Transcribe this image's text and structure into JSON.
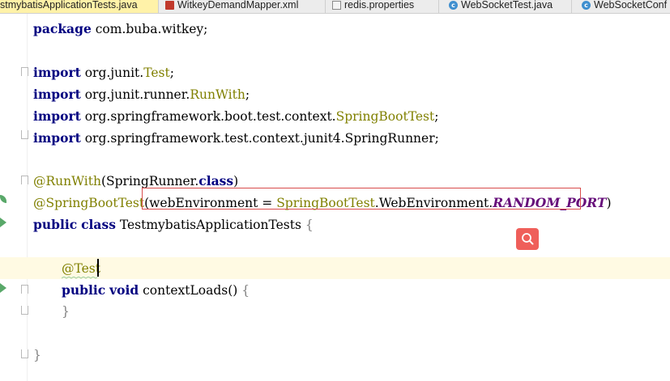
{
  "tabs": [
    {
      "label": "stmybatisApplicationTests.java",
      "icon": "java-class-icon",
      "active": true
    },
    {
      "label": "WitkeyDemandMapper.xml",
      "icon": "xml-file-icon",
      "active": false
    },
    {
      "label": "redis.properties",
      "icon": "properties-file-icon",
      "active": false
    },
    {
      "label": "WebSocketTest.java",
      "icon": "java-class-icon",
      "active": false
    },
    {
      "label": "WebSocketConf",
      "icon": "java-class-icon",
      "active": false
    }
  ],
  "code": {
    "package_kw": "package",
    "package_name": " com.buba.witkey;",
    "imports": [
      {
        "kw": "import",
        "prefix": " org.junit.",
        "cls": "Test",
        "suffix": ";"
      },
      {
        "kw": "import",
        "prefix": " org.junit.runner.",
        "cls": "RunWith",
        "suffix": ";"
      },
      {
        "kw": "import",
        "prefix": " org.springframework.boot.test.context.",
        "cls": "SpringBootTest",
        "suffix": ";"
      },
      {
        "kw": "import",
        "prefix": " org.springframework.test.context.junit4.",
        "cls": "SpringRunner",
        "suffix": ";"
      }
    ],
    "runwith": {
      "ann": "@RunWith",
      "open": "(SpringRunner.",
      "kw": "class",
      "close": ")"
    },
    "springboot": {
      "ann": "@SpringBootTest",
      "p1": "(",
      "p2": "webEnvironment = ",
      "p3": "SpringBootTest",
      "p4": ".WebEnvironment.",
      "p5": "RANDOM_PORT",
      "p6": ")"
    },
    "class_decl": {
      "kw1": "public",
      "kw2": "class",
      "name": " TestmybatisApplicationTests ",
      "brace": "{"
    },
    "test_ann": "@Test",
    "method": {
      "kw1": "public",
      "kw2": "void",
      "name": " contextLoads() ",
      "brace": "{"
    },
    "method_close": "}",
    "class_close": "}"
  },
  "colors": {
    "highlight_border": "#d94c4c",
    "search_button": "#ef5f5a",
    "caret_line": "#fffae3"
  }
}
